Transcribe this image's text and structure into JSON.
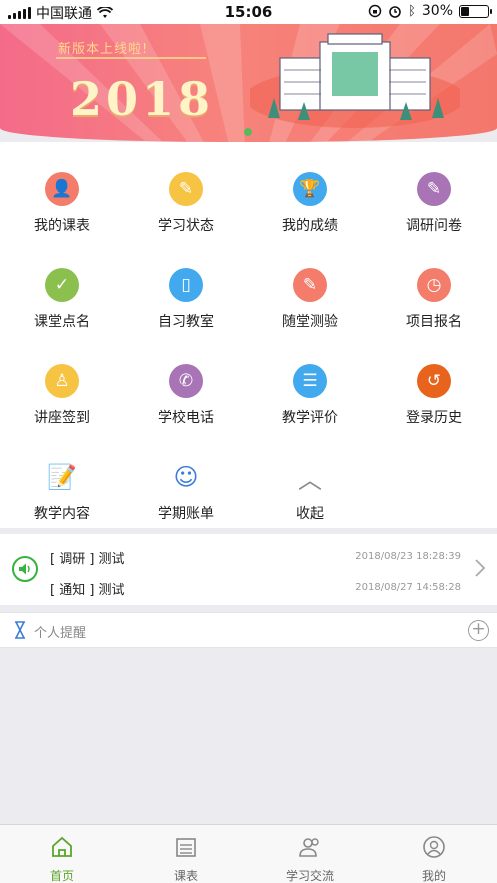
{
  "status_bar": {
    "carrier": "中国联通",
    "time": "15:06",
    "battery": "30%",
    "battery_level": 0.3
  },
  "banner": {
    "slogan": "新版本上线啦!",
    "year": "2018"
  },
  "colors": {
    "accent": "#5aa52c",
    "banner": "#f4776c"
  },
  "grid": {
    "items": [
      {
        "label": "我的课表",
        "icon": "user-schedule-icon",
        "color": "#f47c6b",
        "glyph": "👤"
      },
      {
        "label": "学习状态",
        "icon": "pencil-icon",
        "color": "#f7c342",
        "glyph": "✎"
      },
      {
        "label": "我的成绩",
        "icon": "trophy-icon",
        "color": "#42a9ef",
        "glyph": "🏆"
      },
      {
        "label": "调研问卷",
        "icon": "questionnaire-icon",
        "color": "#a874b5",
        "glyph": "✎"
      },
      {
        "label": "课堂点名",
        "icon": "roll-call-icon",
        "color": "#8cc04e",
        "glyph": "✓"
      },
      {
        "label": "自习教室",
        "icon": "door-icon",
        "color": "#42a9ef",
        "glyph": "▯"
      },
      {
        "label": "随堂测验",
        "icon": "quiz-icon",
        "color": "#f47c6b",
        "glyph": "✎"
      },
      {
        "label": "项目报名",
        "icon": "clock-icon",
        "color": "#f47c6b",
        "glyph": "◷"
      },
      {
        "label": "讲座签到",
        "icon": "podium-icon",
        "color": "#f7c342",
        "glyph": "♙"
      },
      {
        "label": "学校电话",
        "icon": "phone-icon",
        "color": "#a874b5",
        "glyph": "✆"
      },
      {
        "label": "教学评价",
        "icon": "list-icon",
        "color": "#42a9ef",
        "glyph": "☰"
      },
      {
        "label": "登录历史",
        "icon": "history-icon",
        "color": "#e8641c",
        "glyph": "↺"
      },
      {
        "label": "教学内容",
        "icon": "notepad-icon",
        "color": "#3b7dd8",
        "glyph": "📝"
      },
      {
        "label": "学期账单",
        "icon": "bill-icon",
        "color": "#3b7dd8",
        "glyph": "☺"
      },
      {
        "label": "收起",
        "icon": "chevron-up-icon",
        "color": "#888888",
        "glyph": "︿"
      }
    ]
  },
  "notices": [
    {
      "text": "[ 调研 ] 测试",
      "time": "2018/08/23 18:28:39"
    },
    {
      "text": "[ 通知 ] 测试",
      "time": "2018/08/27 14:58:28"
    }
  ],
  "reminder": {
    "label": "个人提醒"
  },
  "tabs": [
    {
      "label": "首页",
      "icon": "home-icon",
      "active": true
    },
    {
      "label": "课表",
      "icon": "schedule-icon",
      "active": false
    },
    {
      "label": "学习交流",
      "icon": "people-icon",
      "active": false
    },
    {
      "label": "我的",
      "icon": "profile-icon",
      "active": false
    }
  ]
}
